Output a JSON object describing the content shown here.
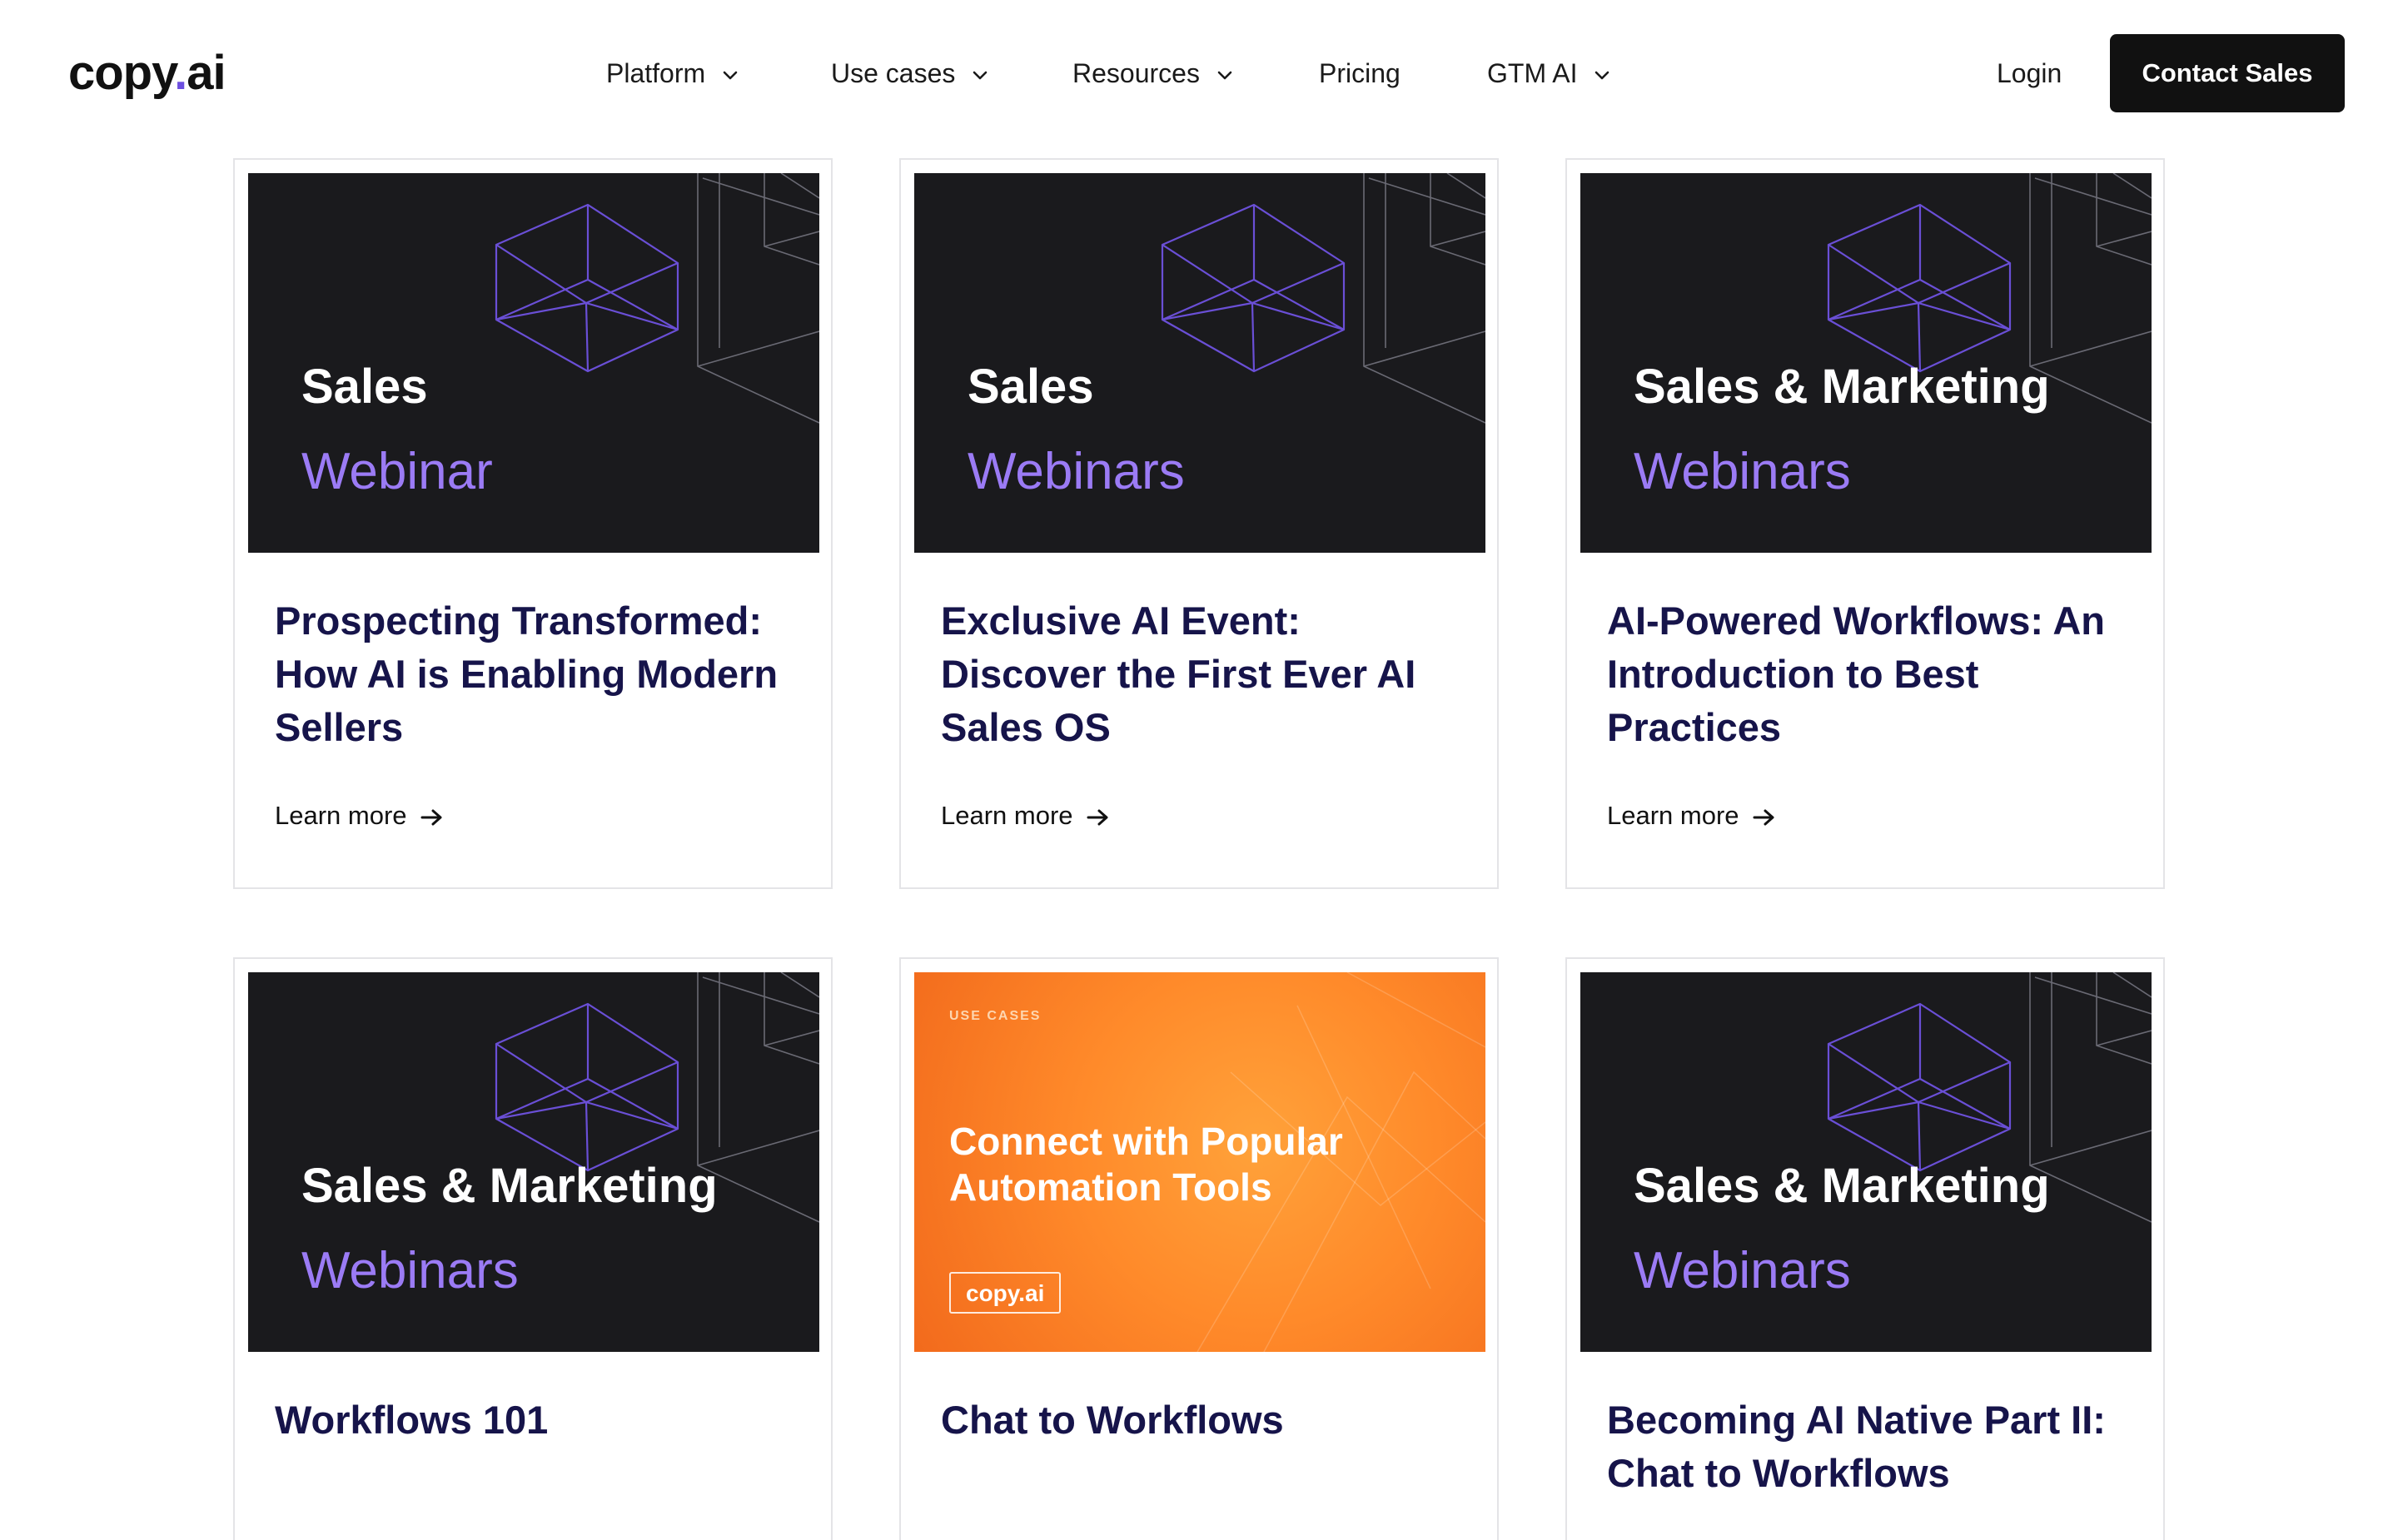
{
  "brand": {
    "logo_text": "copy",
    "logo_dot": ".",
    "logo_suffix": "ai",
    "accent": "#6d4fe0"
  },
  "nav": {
    "items": [
      {
        "label": "Platform",
        "dropdown": true
      },
      {
        "label": "Use cases",
        "dropdown": true
      },
      {
        "label": "Resources",
        "dropdown": true
      },
      {
        "label": "Pricing",
        "dropdown": false
      },
      {
        "label": "GTM AI",
        "dropdown": true
      }
    ],
    "login_label": "Login",
    "cta_label": "Contact Sales"
  },
  "cards": [
    {
      "thumb_title": "Sales",
      "thumb_subtitle": "Webinar",
      "title": "Prospecting Transformed: How AI is Enabling Modern Sellers",
      "link": "Learn more"
    },
    {
      "thumb_title": "Sales",
      "thumb_subtitle": "Webinars",
      "title": "Exclusive AI Event: Discover the First Ever AI Sales OS",
      "link": "Learn more"
    },
    {
      "thumb_title": "Sales & Marketing",
      "thumb_subtitle": "Webinars",
      "title": "AI-Powered Workflows: An Introduction to Best Practices",
      "link": "Learn more"
    },
    {
      "thumb_title": "Sales & Marketing",
      "thumb_subtitle": "Webinars",
      "title": "Workflows 101"
    },
    {
      "thumb_tag": "USE CASES",
      "thumb_headline": "Connect with Popular Automation Tools",
      "thumb_badge": "copy.ai",
      "title": "Chat to Workflows"
    },
    {
      "thumb_title": "Sales & Marketing",
      "thumb_subtitle": "Webinars",
      "title": "Becoming AI Native Part II: Chat to Workflows"
    }
  ],
  "colors": {
    "card_title": "#16144a",
    "thumb_dark": "#1a1a1d",
    "thumb_accent_text": "#9b7bf5",
    "thumb_orange": "#ff8a2a",
    "cta_bg": "#111111"
  }
}
